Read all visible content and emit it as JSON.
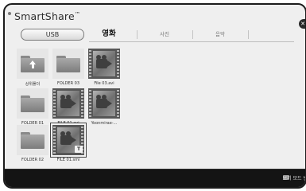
{
  "header": {
    "app_title": "SmartShare",
    "trademark": "™",
    "source_button": "USB",
    "close_symbol": "✕"
  },
  "tabs": [
    {
      "label": "영화",
      "active": true
    },
    {
      "label": "사진",
      "active": false
    },
    {
      "label": "음악",
      "active": false
    }
  ],
  "items": [
    {
      "label": "상위폴더",
      "kind": "parent-folder"
    },
    {
      "label": "FOLDER 03",
      "kind": "folder"
    },
    {
      "label": "File 03.avi",
      "kind": "video"
    },
    {
      "label": "FOLDER 01",
      "kind": "folder"
    },
    {
      "label": "FILE 01.avi",
      "kind": "video"
    },
    {
      "label": "Yoonmirae-...",
      "kind": "video"
    },
    {
      "label": "FOLDER 02",
      "kind": "folder"
    },
    {
      "label": "FILE 01.smi",
      "kind": "video",
      "selected": true,
      "badge": "T"
    }
  ],
  "footer": {
    "view_mode_label": "보기 모드 변"
  },
  "colors": {
    "background": "#efefef",
    "footer": "#141414",
    "thumbnail": "#575757"
  }
}
